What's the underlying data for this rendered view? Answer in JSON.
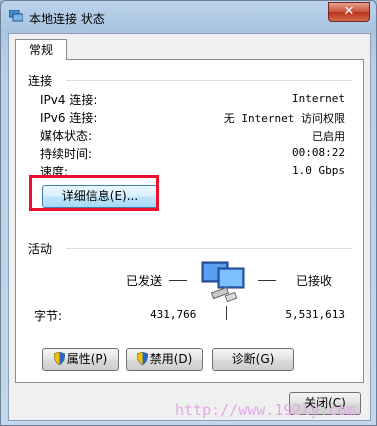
{
  "window": {
    "title": "本地连接 状态",
    "close_glyph": "✕"
  },
  "tab": {
    "label": "常规"
  },
  "connection": {
    "title": "连接",
    "rows": [
      {
        "label": "IPv4 连接:",
        "value": "Internet"
      },
      {
        "label": "IPv6 连接:",
        "value": "无 Internet 访问权限"
      },
      {
        "label": "媒体状态:",
        "value": "已启用"
      },
      {
        "label": "持续时间:",
        "value": "00:08:22"
      },
      {
        "label": "速度:",
        "value": "1.0 Gbps"
      }
    ],
    "details_button": "详细信息(E)..."
  },
  "activity": {
    "title": "活动",
    "sent_label": "已发送",
    "received_label": "已接收",
    "bytes_label": "字节:",
    "bytes_sent": "431,766",
    "bytes_received": "5,531,613"
  },
  "buttons": {
    "properties": "属性(P)",
    "disable": "禁用(D)",
    "diagnose": "诊断(G)",
    "close": "关闭(C)"
  },
  "watermark": "http://www.192ly.com"
}
